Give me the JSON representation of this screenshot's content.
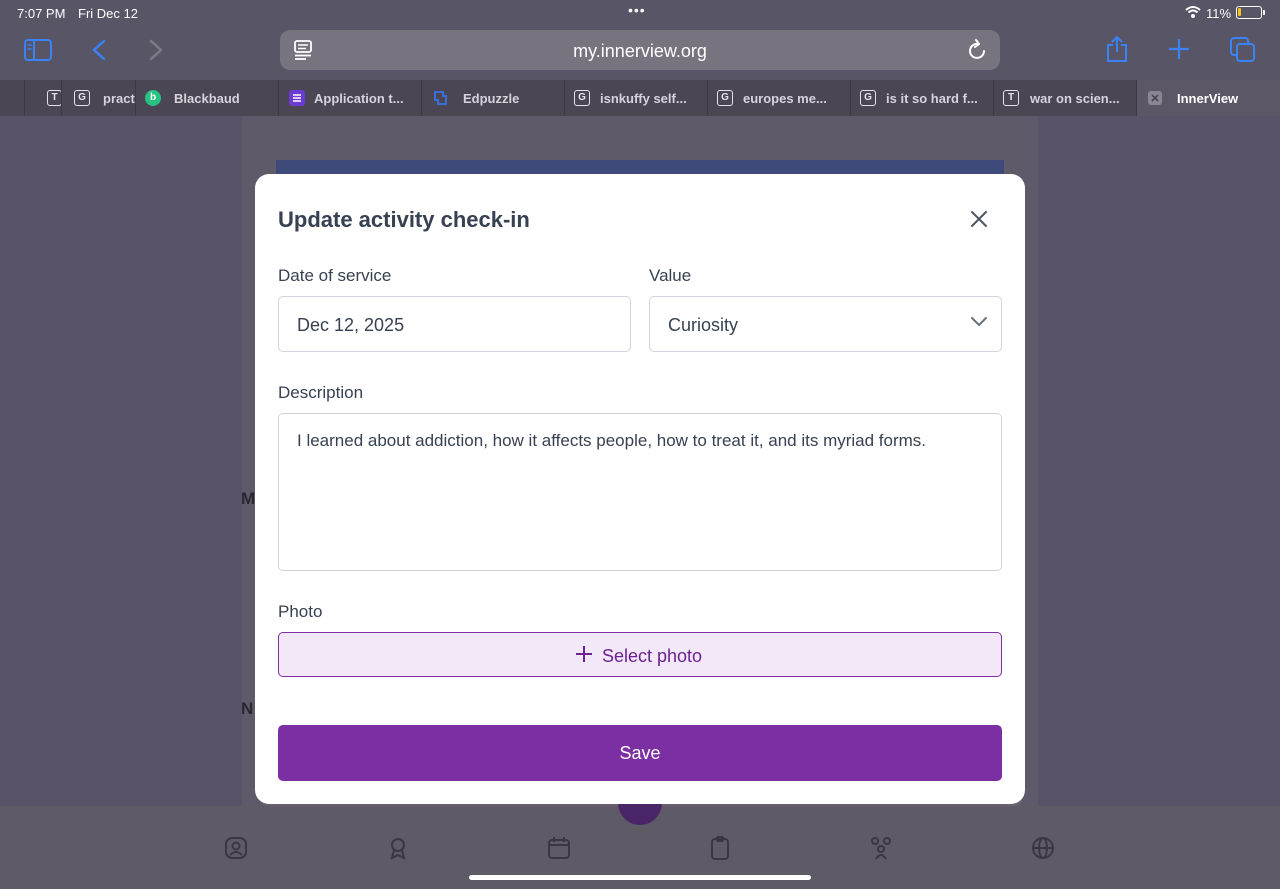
{
  "status_bar": {
    "time": "7:07 PM",
    "date": "Fri Dec 12",
    "battery": "11%"
  },
  "browser": {
    "url": "my.innerview.org",
    "tabs": [
      {
        "label": "",
        "icon": "T"
      },
      {
        "label": "pract",
        "icon": "G"
      },
      {
        "label": "Blackbaud",
        "icon": "b"
      },
      {
        "label": "Application t...",
        "icon": "list"
      },
      {
        "label": "Edpuzzle",
        "icon": "edpuzzle"
      },
      {
        "label": "isnkuffy self...",
        "icon": "G"
      },
      {
        "label": "europes me...",
        "icon": "G"
      },
      {
        "label": "is it so hard f...",
        "icon": "G"
      },
      {
        "label": "war on scien...",
        "icon": "T"
      },
      {
        "label": "InnerView",
        "icon": "close",
        "active": true
      }
    ]
  },
  "background": {
    "letter_m": "M",
    "letter_n": "N"
  },
  "modal": {
    "title": "Update activity check-in",
    "date_label": "Date of service",
    "date_value": "Dec 12, 2025",
    "value_label": "Value",
    "value_selected": "Curiosity",
    "description_label": "Description",
    "description_value": "I learned about addiction, how it affects people, how to treat it, and its myriad forms.",
    "photo_label": "Photo",
    "photo_button": "Select photo",
    "save_button": "Save"
  },
  "colors": {
    "accent": "#7b2fa3",
    "photo_bg": "#f3e8f7"
  }
}
